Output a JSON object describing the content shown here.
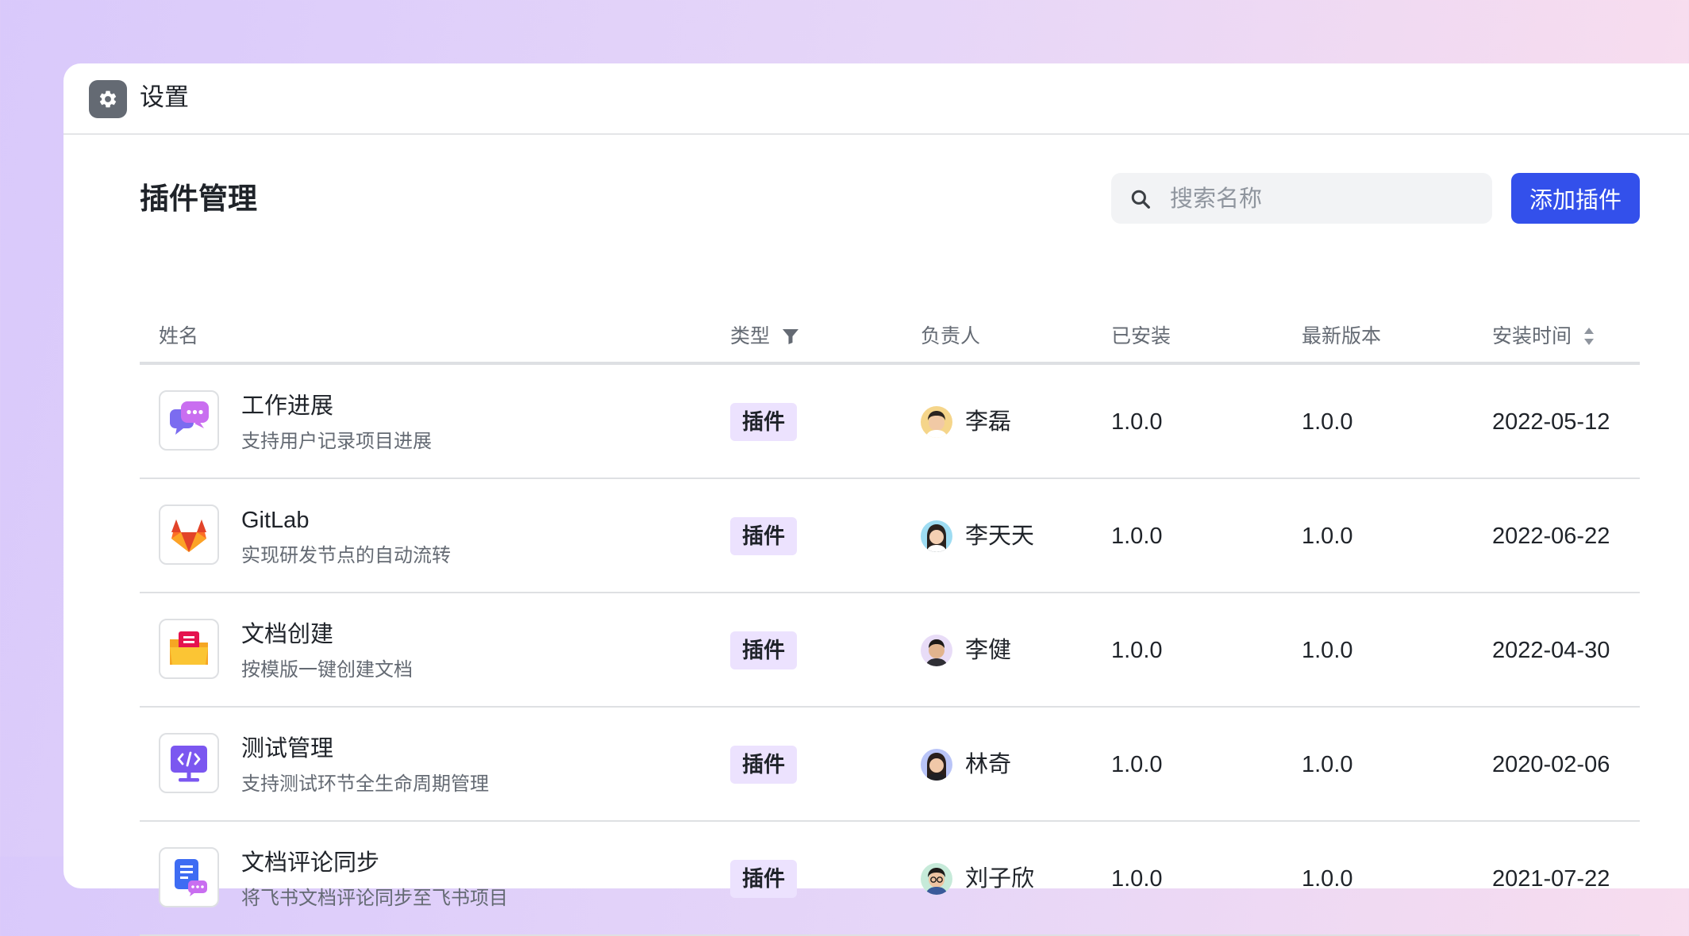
{
  "app": {
    "title": "设置"
  },
  "page": {
    "title": "插件管理"
  },
  "search": {
    "placeholder": "搜索名称",
    "value": ""
  },
  "toolbar": {
    "add_label": "添加插件"
  },
  "colors": {
    "accent": "#3350eb",
    "tag_bg": "#ece2fe",
    "divider": "#dee0e3"
  },
  "table": {
    "headers": {
      "name": "姓名",
      "type": "类型",
      "owner": "负责人",
      "installed": "已安装",
      "latest": "最新版本",
      "install_time": "安装时间"
    },
    "rows": [
      {
        "icon": "chat-bubbles-icon",
        "name": "工作进展",
        "desc": "支持用户记录项目进展",
        "type": "插件",
        "owner": "李磊",
        "installed": "1.0.0",
        "latest": "1.0.0",
        "install_time": "2022-05-12"
      },
      {
        "icon": "gitlab-fox-icon",
        "name": "GitLab",
        "desc": "实现研发节点的自动流转",
        "type": "插件",
        "owner": "李天天",
        "installed": "1.0.0",
        "latest": "1.0.0",
        "install_time": "2022-06-22"
      },
      {
        "icon": "folder-document-icon",
        "name": "文档创建",
        "desc": "按模版一键创建文档",
        "type": "插件",
        "owner": "李健",
        "installed": "1.0.0",
        "latest": "1.0.0",
        "install_time": "2022-04-30"
      },
      {
        "icon": "monitor-code-icon",
        "name": "测试管理",
        "desc": "支持测试环节全生命周期管理",
        "type": "插件",
        "owner": "林奇",
        "installed": "1.0.0",
        "latest": "1.0.0",
        "install_time": "2020-02-06"
      },
      {
        "icon": "doc-comment-icon",
        "name": "文档评论同步",
        "desc": "将飞书文档评论同步至飞书项目",
        "type": "插件",
        "owner": "刘子欣",
        "installed": "1.0.0",
        "latest": "1.0.0",
        "install_time": "2021-07-22"
      }
    ]
  }
}
